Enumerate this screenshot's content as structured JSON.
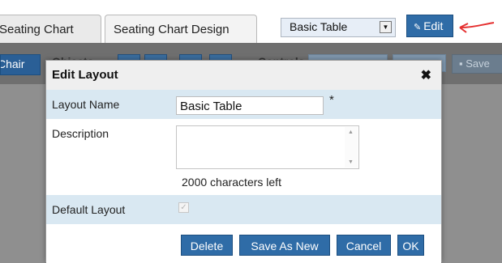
{
  "tabs": [
    {
      "label": "Seating Chart"
    },
    {
      "label": "Seating Chart Design"
    }
  ],
  "layout_select": {
    "value": "Basic Table"
  },
  "edit_button": {
    "label": "Edit"
  },
  "toolbar": {
    "chair_label": "Chair",
    "objects_label": "Objects",
    "controls_label": "Controls",
    "save_label": "Save"
  },
  "dialog": {
    "title": "Edit Layout",
    "close_symbol": "✖",
    "layout_name_label": "Layout Name",
    "layout_name_value": "Basic Table",
    "required_mark": "*",
    "description_label": "Description",
    "description_value": "",
    "chars_left": "2000 characters left",
    "default_layout_label": "Default Layout",
    "default_layout_checked": true,
    "buttons": {
      "delete": "Delete",
      "save_as_new": "Save As New",
      "cancel": "Cancel",
      "ok": "OK"
    }
  },
  "colors": {
    "button_blue": "#2f6ca7",
    "row_shade": "#d9e8f2",
    "arrow_red": "#e53030"
  }
}
